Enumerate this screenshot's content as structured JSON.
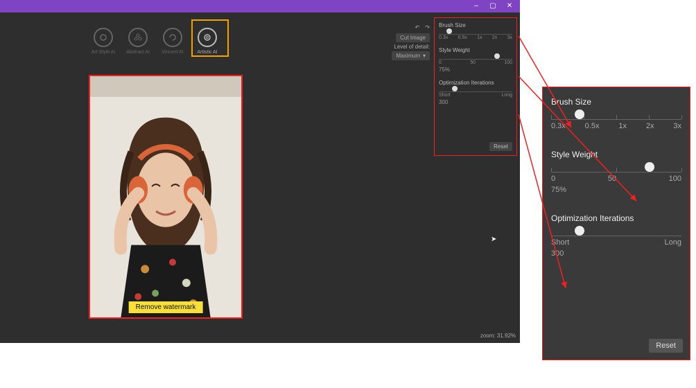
{
  "window": {
    "controls": {
      "min": "–",
      "max": "▢",
      "close": "✕"
    }
  },
  "tools": [
    {
      "label": "Art Style AI"
    },
    {
      "label": "Abstract AI"
    },
    {
      "label": "Vincent AI"
    },
    {
      "label": "Artistic AI"
    }
  ],
  "right_controls": {
    "cut_image": "Cut Image",
    "detail_label": "Level of detail:",
    "detail_value": "Maximum"
  },
  "sliders_small": {
    "brush": {
      "label": "Brush Size",
      "ticks": [
        "0.3x",
        "0.5x",
        "1x",
        "2x",
        "3x"
      ],
      "thumb_pct": 10
    },
    "style": {
      "label": "Style Weight",
      "ticks": [
        "0",
        "50",
        "100"
      ],
      "thumb_pct": 75,
      "value": "75%"
    },
    "opt": {
      "label": "Optimization Iterations",
      "ticks": [
        "Short",
        "Long"
      ],
      "thumb_pct": 18,
      "value": "300"
    },
    "reset": "Reset"
  },
  "sliders_big": {
    "brush": {
      "label": "Brush Size",
      "ticks": [
        "0.3x",
        "0.5x",
        "1x",
        "2x",
        "3x"
      ],
      "thumb_pct": 18
    },
    "style": {
      "label": "Style Weight",
      "ticks": [
        "0",
        "50",
        "100"
      ],
      "thumb_pct": 72,
      "value": "75%"
    },
    "opt": {
      "label": "Optimization Iterations",
      "ticks": [
        "Short",
        "Long"
      ],
      "thumb_pct": 18,
      "value": "300"
    },
    "reset": "Reset"
  },
  "canvas": {
    "remove_watermark": "Remove watermark",
    "zoom_label": "zoom: 31.92%"
  }
}
